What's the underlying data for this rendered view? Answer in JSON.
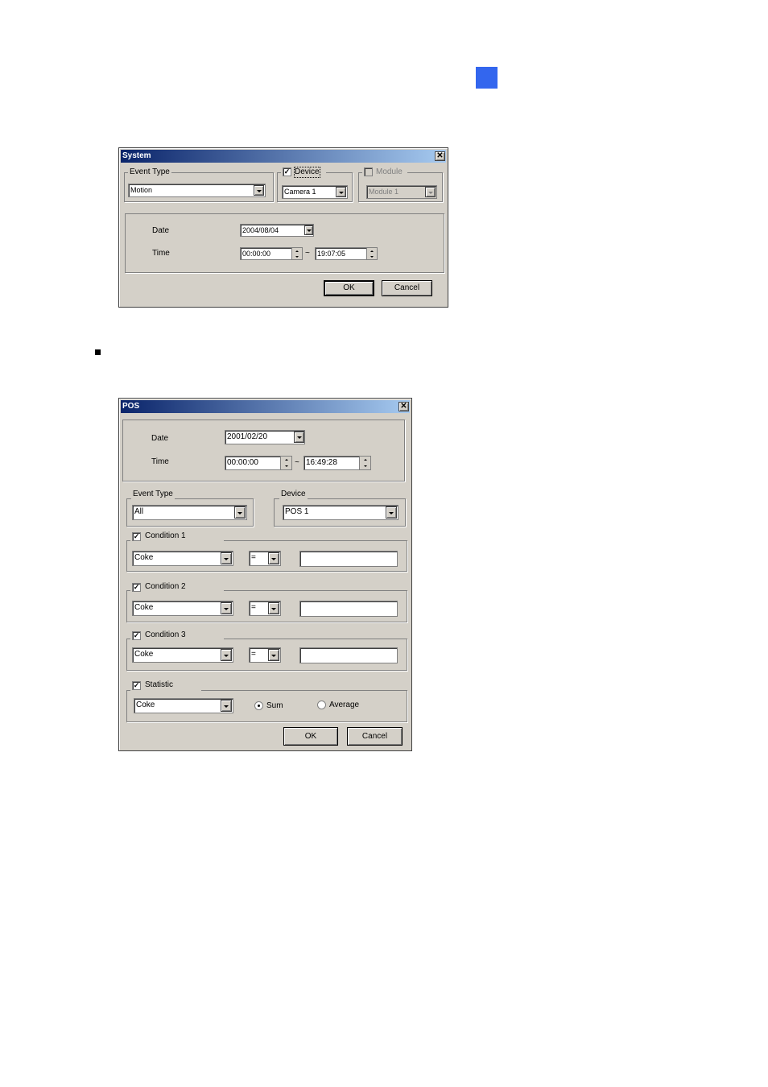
{
  "system_dialog": {
    "title": "System",
    "close_glyph": "✕",
    "event_type": {
      "label": "Event Type",
      "value": "Motion"
    },
    "device": {
      "label": "Device",
      "checked": true,
      "check_glyph": "✓",
      "value": "Camera 1"
    },
    "module": {
      "label": "Module",
      "checked": false,
      "value": "Module 1"
    },
    "date": {
      "label": "Date",
      "value": "2004/08/04"
    },
    "time": {
      "label": "Time",
      "from": "00:00:00",
      "separator": "~",
      "to": "19:07:05"
    },
    "ok_label": "OK",
    "cancel_label": "Cancel"
  },
  "pos_dialog": {
    "title": "POS",
    "close_glyph": "✕",
    "date": {
      "label": "Date",
      "value": "2001/02/20"
    },
    "time": {
      "label": "Time",
      "from": "00:00:00",
      "separator": "~",
      "to": "16:49:28"
    },
    "event_type": {
      "label": "Event Type",
      "value": "All"
    },
    "device": {
      "label": "Device",
      "value": "POS 1"
    },
    "conditions": [
      {
        "label": "Condition 1",
        "checked": true,
        "check_glyph": "✓",
        "item": "Coke",
        "operator": "=",
        "value": ""
      },
      {
        "label": "Condition 2",
        "checked": true,
        "check_glyph": "✓",
        "item": "Coke",
        "operator": "=",
        "value": ""
      },
      {
        "label": "Condition 3",
        "checked": true,
        "check_glyph": "✓",
        "item": "Coke",
        "operator": "=",
        "value": ""
      }
    ],
    "statistic": {
      "label": "Statistic",
      "checked": true,
      "check_glyph": "✓",
      "item": "Coke",
      "options": [
        "Sum",
        "Average"
      ],
      "selected": "Sum"
    },
    "ok_label": "OK",
    "cancel_label": "Cancel"
  },
  "colors": {
    "title_start": "#0a246a",
    "title_end": "#a6caf0",
    "face": "#d4d0c8",
    "page_marker": "#3366ee"
  },
  "icons": [
    "close-icon",
    "dropdown-arrow-icon",
    "spin-up-icon",
    "spin-down-icon",
    "checkmark-icon",
    "radio-dot-icon"
  ]
}
